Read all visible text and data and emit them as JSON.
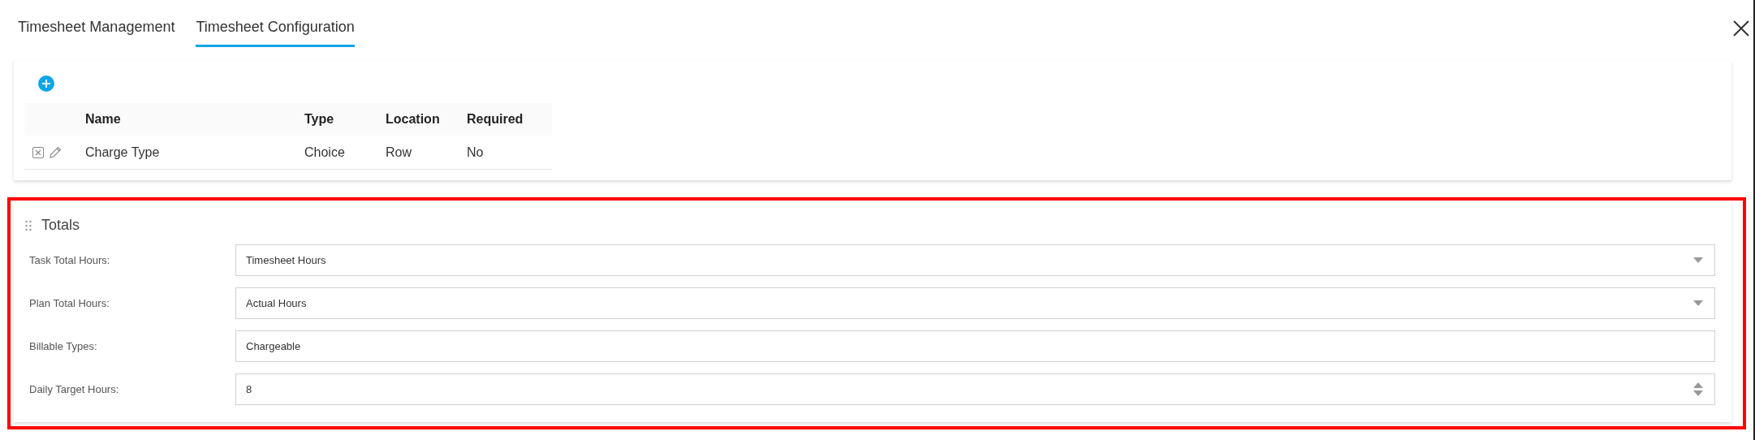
{
  "tabs": [
    {
      "label": "Timesheet Management",
      "selected": false
    },
    {
      "label": "Timesheet Configuration",
      "selected": true
    }
  ],
  "fields_table": {
    "columns": [
      "Name",
      "Type",
      "Location",
      "Required"
    ],
    "rows": [
      {
        "cells": [
          "Charge Type",
          "Choice",
          "Row",
          "No"
        ]
      }
    ]
  },
  "totals": {
    "title": "Totals",
    "fields": [
      {
        "kind": "dropdown",
        "label": "Task Total Hours:",
        "value": "Timesheet Hours"
      },
      {
        "kind": "dropdown",
        "label": "Plan Total Hours:",
        "value": "Actual Hours"
      },
      {
        "kind": "text",
        "label": "Billable Types:",
        "value": "Chargeable"
      },
      {
        "kind": "number",
        "label": "Daily Target Hours:",
        "value": "8"
      }
    ]
  }
}
